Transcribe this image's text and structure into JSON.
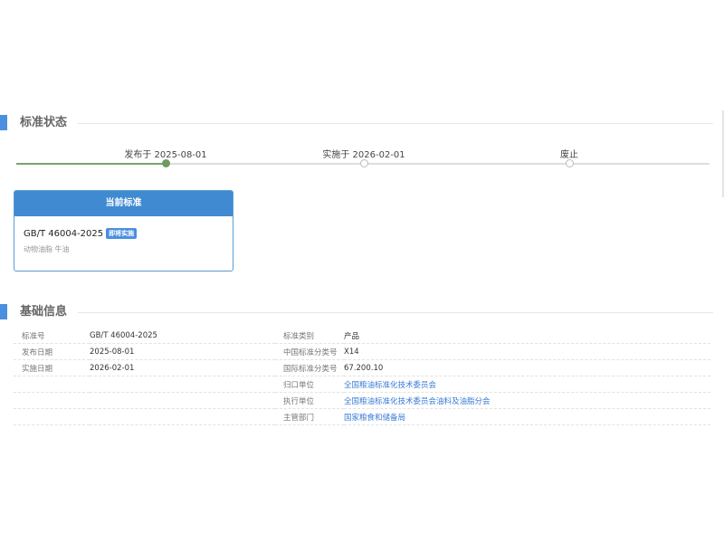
{
  "status_section": {
    "title": "标准状态"
  },
  "timeline": {
    "steps": [
      {
        "label": "发布于 2025-08-01"
      },
      {
        "label": "实施于 2026-02-01"
      },
      {
        "label": "废止"
      }
    ]
  },
  "current_card": {
    "header": "当前标准",
    "code": "GB/T 46004-2025",
    "badge": "即将实施",
    "subtitle": "动物油脂 牛油"
  },
  "basic_section": {
    "title": "基础信息"
  },
  "basic_info": {
    "rows": [
      {
        "k1": "标准号",
        "v1": "GB/T 46004-2025",
        "k2": "标准类别",
        "v2": "产品"
      },
      {
        "k1": "发布日期",
        "v1": "2025-08-01",
        "k2": "中国标准分类号",
        "v2": "X14"
      },
      {
        "k1": "实施日期",
        "v1": "2026-02-01",
        "k2": "国际标准分类号",
        "v2": "67.200.10"
      },
      {
        "k1": "",
        "v1": "",
        "k2": "归口单位",
        "v2": "全国粮油标准化技术委员会"
      },
      {
        "k1": "",
        "v1": "",
        "k2": "执行单位",
        "v2": "全国粮油标准化技术委员会油料及油脂分会"
      },
      {
        "k1": "",
        "v1": "",
        "k2": "主管部门",
        "v2": "国家粮食和储备局"
      }
    ]
  }
}
